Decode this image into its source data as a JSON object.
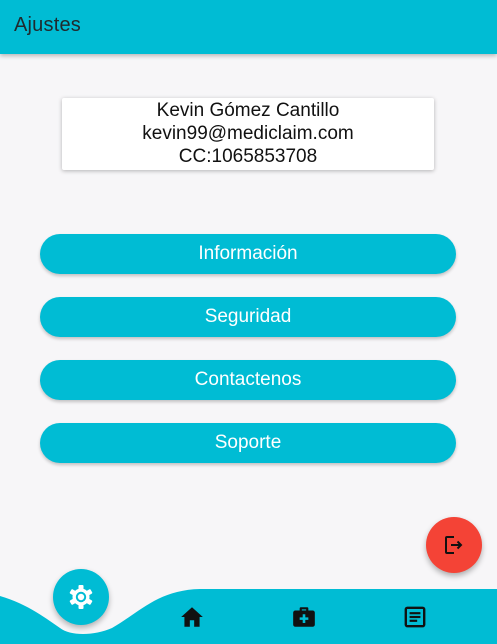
{
  "app_bar": {
    "title": "Ajustes"
  },
  "profile": {
    "name": "Kevin Gómez Cantillo",
    "email": "kevin99@mediclaim.com",
    "document": "CC:1065853708"
  },
  "menu": {
    "info_label": "Información",
    "security_label": "Seguridad",
    "contact_label": "Contactenos",
    "support_label": "Soporte"
  },
  "bottom_nav": {
    "items": [
      "settings-icon",
      "home-icon",
      "medical-kit-icon",
      "document-list-icon"
    ],
    "active": "settings-icon"
  },
  "colors": {
    "accent": "#00bcd4",
    "logout": "#f44336",
    "background": "#f7f6f8"
  }
}
